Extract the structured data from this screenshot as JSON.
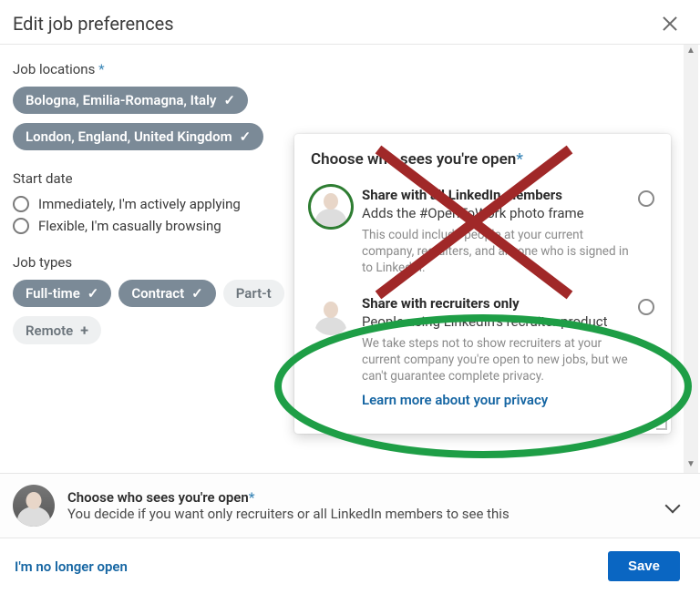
{
  "header": {
    "title": "Edit job preferences"
  },
  "locations": {
    "label": "Job locations",
    "required_mark": "*",
    "items": [
      {
        "text": "Bologna, Emilia-Romagna, Italy",
        "selected": true
      },
      {
        "text": "London, England, United Kingdom",
        "selected": true
      }
    ]
  },
  "start_date": {
    "label": "Start date",
    "options": [
      {
        "text": "Immediately, I'm actively applying"
      },
      {
        "text": "Flexible, I'm casually browsing"
      }
    ]
  },
  "job_types": {
    "label": "Job types",
    "items": [
      {
        "text": "Full-time",
        "state": "selected"
      },
      {
        "text": "Contract",
        "state": "selected"
      },
      {
        "text": "Part-t",
        "state": "unselected"
      },
      {
        "text": "Remote",
        "state": "add"
      }
    ]
  },
  "popover": {
    "title": "Choose who sees you're open",
    "required_mark": "*",
    "options": [
      {
        "heading": "Share with all LinkedIn members",
        "sub": "Adds the #OpenToWork photo frame",
        "desc": "This could include people at your current company, recruiters, and anyone who is signed in to LinkedIn."
      },
      {
        "heading": "Share with recruiters only",
        "sub": "People using LinkedIn's recruiter product",
        "desc": "We take steps not to show recruiters at your current company you're open to new jobs, but we can't guarantee complete privacy."
      }
    ],
    "privacy_link": "Learn more about your privacy"
  },
  "summary": {
    "title": "Choose who sees you're open",
    "required_mark": "*",
    "desc": "You decide if you want only recruiters or all LinkedIn members to see this"
  },
  "footer": {
    "no_longer": "I'm no longer open",
    "save": "Save"
  },
  "annotation_colors": {
    "no": "#a02828",
    "yes": "#1e9e46"
  }
}
